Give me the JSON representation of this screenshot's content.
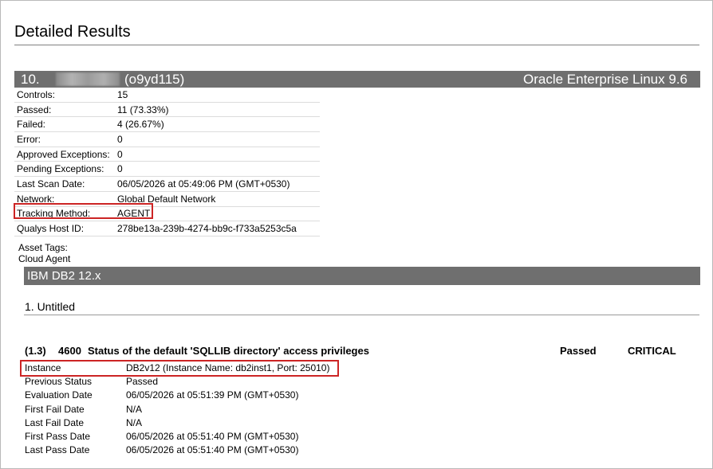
{
  "page": {
    "title": "Detailed Results"
  },
  "host": {
    "ip_prefix": "10.",
    "hostname": "(o9yd115)",
    "os": "Oracle Enterprise Linux 9.6"
  },
  "summary": [
    {
      "label": "Controls:",
      "value": "15"
    },
    {
      "label": "Passed:",
      "value": "11 (73.33%)"
    },
    {
      "label": "Failed:",
      "value": "4 (26.67%)"
    },
    {
      "label": "Error:",
      "value": "0"
    },
    {
      "label": "Approved Exceptions:",
      "value": "0"
    },
    {
      "label": "Pending Exceptions:",
      "value": "0"
    },
    {
      "label": "Last Scan Date:",
      "value": "06/05/2026 at 05:49:06 PM (GMT+0530)"
    },
    {
      "label": "Network:",
      "value": "Global Default Network"
    },
    {
      "label": "Tracking Method:",
      "value": "AGENT"
    },
    {
      "label": "Qualys Host ID:",
      "value": "278be13a-239b-4274-bb9c-f733a5253c5a"
    }
  ],
  "asset_tags": {
    "label": "Asset Tags:",
    "value": "Cloud Agent"
  },
  "module": {
    "name": "IBM DB2 12.x"
  },
  "section": {
    "title": "1. Untitled"
  },
  "control": {
    "number": "(1.3)",
    "id": "4600",
    "title": "Status of the default 'SQLLIB directory' access privileges",
    "status": "Passed",
    "criticality": "CRITICAL",
    "details": [
      {
        "label": "Instance",
        "value": "DB2v12 (Instance Name: db2inst1, Port: 25010)"
      },
      {
        "label": "Previous Status",
        "value": "Passed"
      },
      {
        "label": "Evaluation Date",
        "value": "06/05/2026 at 05:51:39 PM (GMT+0530)"
      },
      {
        "label": "First Fail Date",
        "value": "N/A"
      },
      {
        "label": "Last Fail Date",
        "value": "N/A"
      },
      {
        "label": "First Pass Date",
        "value": "06/05/2026 at 05:51:40 PM (GMT+0530)"
      },
      {
        "label": "Last Pass Date",
        "value": "06/05/2026 at 05:51:40 PM (GMT+0530)"
      }
    ]
  },
  "colors": {
    "bar": "#6f6f6f",
    "highlight": "#cc2424"
  }
}
